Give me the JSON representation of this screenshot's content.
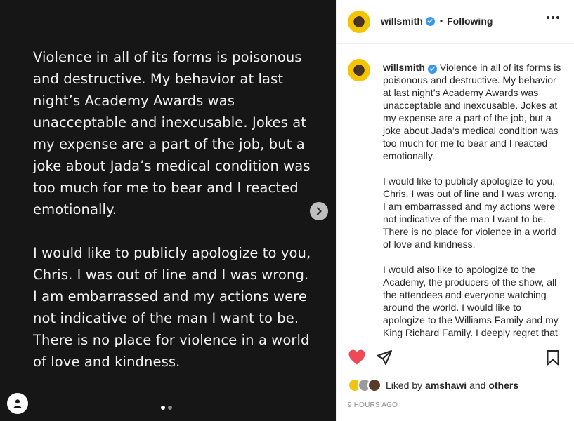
{
  "media": {
    "paragraphs": [
      "Violence in all of its forms is poisonous\nand destructive. My behavior at last\nnight’s Academy Awards was\nunacceptable and inexcusable. Jokes at\nmy expense are a part of the job, but a\njoke about Jada’s medical condition was\ntoo much for me to bear and I reacted\nemotionally.",
      "I would like to publicly apologize to you,\nChris. I was out of line and I was wrong.\nI am embarrassed and my actions were\nnot indicative of the man I want to be.\nThere is no place for violence in a world\nof love and kindness."
    ],
    "page_count": 2,
    "active_page": 1
  },
  "header": {
    "username": "willsmith",
    "separator": "•",
    "follow_status": "Following"
  },
  "caption": {
    "username": "willsmith",
    "paragraph_1": "Violence in all of its forms is poisonous and destructive. My behavior at last night’s Academy Awards was unacceptable and inexcusable. Jokes at my expense are a part of the job, but a joke about Jada’s medical condition was too much for me to bear and I reacted emotionally.",
    "paragraph_2": "I would like to publicly apologize to you, Chris. I was out of line and I was wrong. I am embarrassed and my actions were not indicative of the man I want to be. There is no place for violence in a world of love and kindness.",
    "paragraph_3": "I would also like to apologize to the Academy, the producers of the show, all the attendees and everyone watching around the world. I would like to apologize to the Williams Family and my King Richard Family. I deeply regret that"
  },
  "likes": {
    "prefix": "Liked by",
    "user": "amshawi",
    "and": "and",
    "others": "others"
  },
  "timestamp": "9 HOURS AGO",
  "colors": {
    "media_bg": "#161616",
    "heart": "#ed4956",
    "verified": "#3897f0",
    "avatar_ring": "#f4c500"
  }
}
